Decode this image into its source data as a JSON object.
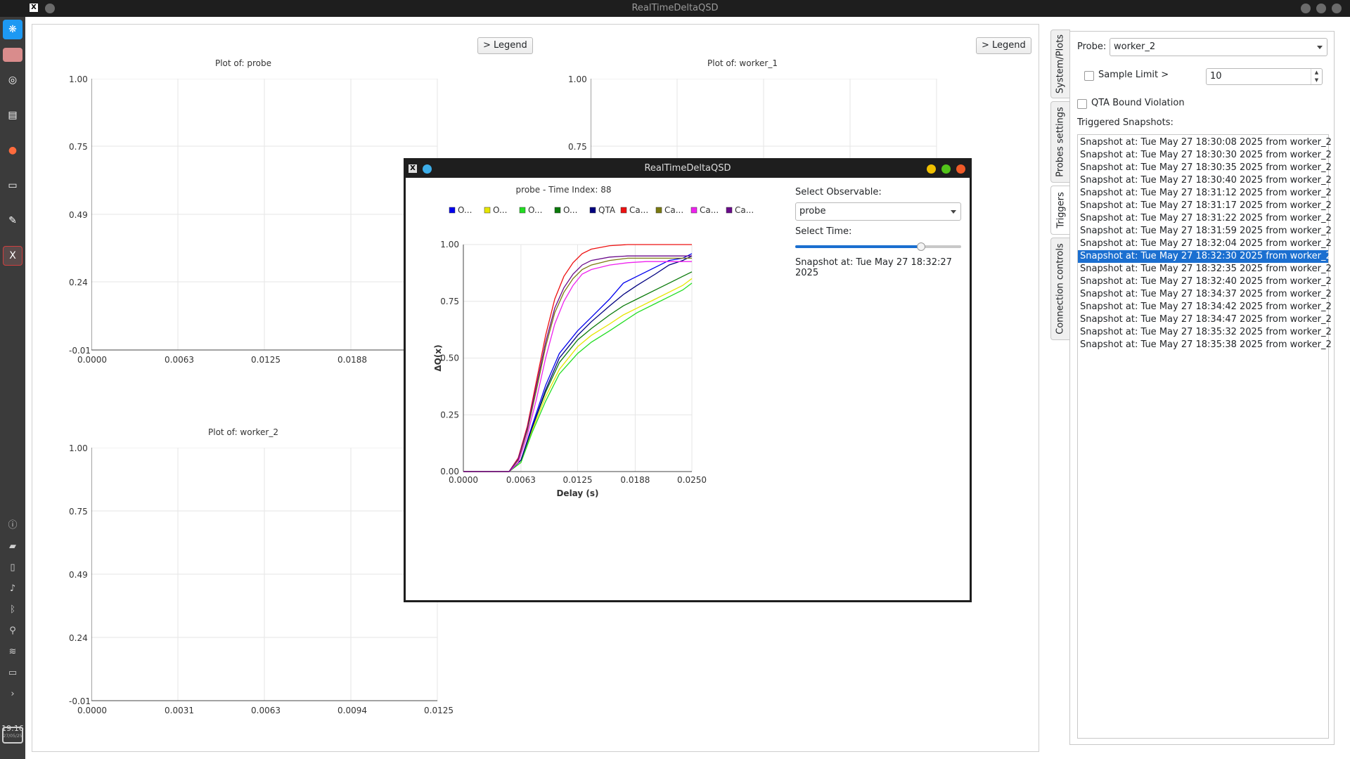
{
  "window": {
    "title": "RealTimeDeltaQSD"
  },
  "dock": {
    "clock_time": "19:16",
    "clock_date": "27/05/25"
  },
  "plots": [
    {
      "title": "Plot of: probe",
      "y_ticks": [
        "1.00",
        "0.75",
        "0.49",
        "0.24",
        "-0.01"
      ],
      "x_ticks": [
        "0.0000",
        "0.0063",
        "0.0125",
        "0.0188"
      ]
    },
    {
      "title": "Plot of: worker_1",
      "y_ticks": [
        "1.00",
        "0.75"
      ],
      "x_ticks": []
    },
    {
      "title": "Plot of: worker_2",
      "y_ticks": [
        "1.00",
        "0.75",
        "0.49",
        "0.24",
        "-0.01"
      ],
      "x_ticks": [
        "0.0000",
        "0.0031",
        "0.0063",
        "0.0094",
        "0.0125"
      ]
    }
  ],
  "legend_buttons": [
    "> Legend",
    "> Legend"
  ],
  "side_tabs": [
    "System/Plots",
    "Probes settings",
    "Triggers",
    "Connection controls"
  ],
  "right_panel": {
    "probe_label": "Probe:",
    "probe_value": "worker_2",
    "sample_limit_label": "Sample Limit >",
    "sample_limit_value": "10",
    "qta_label": "QTA Bound Violation",
    "triggered_label": "Triggered Snapshots:",
    "snapshots": [
      "Snapshot at: Tue May 27 18:30:08 2025 from worker_2",
      "Snapshot at: Tue May 27 18:30:30 2025 from worker_2",
      "Snapshot at: Tue May 27 18:30:35 2025 from worker_2",
      "Snapshot at: Tue May 27 18:30:40 2025 from worker_2",
      "Snapshot at: Tue May 27 18:31:12 2025 from worker_2",
      "Snapshot at: Tue May 27 18:31:17 2025 from worker_2",
      "Snapshot at: Tue May 27 18:31:22 2025 from worker_2",
      "Snapshot at: Tue May 27 18:31:59 2025 from worker_2",
      "Snapshot at: Tue May 27 18:32:04 2025 from worker_2",
      "Snapshot at: Tue May 27 18:32:30 2025 from worker_2",
      "Snapshot at: Tue May 27 18:32:35 2025 from worker_2",
      "Snapshot at: Tue May 27 18:32:40 2025 from worker_2",
      "Snapshot at: Tue May 27 18:34:37 2025 from worker_2",
      "Snapshot at: Tue May 27 18:34:42 2025 from worker_2",
      "Snapshot at: Tue May 27 18:34:47 2025 from worker_2",
      "Snapshot at: Tue May 27 18:35:32 2025 from worker_2",
      "Snapshot at: Tue May 27 18:35:38 2025 from worker_2"
    ],
    "selected_index": 9
  },
  "popup": {
    "title": "RealTimeDeltaQSD",
    "select_observable_label": "Select Observable:",
    "observable_value": "probe",
    "select_time_label": "Select Time:",
    "time_slider_fraction": 0.76,
    "snapshot_text": "Snapshot at: Tue May 27 18:32:27 2025"
  },
  "chart_data": {
    "type": "line",
    "title": "probe - Time Index: 88",
    "xlabel": "Delay (s)",
    "ylabel": "ΔQ(x)",
    "xlim": [
      0,
      0.025
    ],
    "ylim": [
      0,
      1
    ],
    "x_ticks": [
      "0.0000",
      "0.0063",
      "0.0125",
      "0.0188",
      "0.0250"
    ],
    "y_ticks": [
      "0.00",
      "0.25",
      "0.50",
      "0.75",
      "1.00"
    ],
    "grid": true,
    "legend_position": "top",
    "series": [
      {
        "name": "O...",
        "color": "#0000ee",
        "x": [
          0,
          0.005,
          0.0063,
          0.0075,
          0.009,
          0.0105,
          0.0125,
          0.014,
          0.016,
          0.0175,
          0.019,
          0.021,
          0.0225,
          0.024,
          0.025
        ],
        "y": [
          0,
          0,
          0.05,
          0.2,
          0.38,
          0.52,
          0.62,
          0.68,
          0.76,
          0.83,
          0.86,
          0.9,
          0.93,
          0.94,
          0.96
        ]
      },
      {
        "name": "O...",
        "color": "#e6e600",
        "x": [
          0,
          0.005,
          0.0063,
          0.0075,
          0.009,
          0.0105,
          0.0125,
          0.014,
          0.016,
          0.0175,
          0.019,
          0.021,
          0.0225,
          0.024,
          0.025
        ],
        "y": [
          0,
          0,
          0.04,
          0.18,
          0.33,
          0.45,
          0.55,
          0.6,
          0.65,
          0.69,
          0.72,
          0.76,
          0.79,
          0.82,
          0.85
        ]
      },
      {
        "name": "O...",
        "color": "#22dd22",
        "x": [
          0,
          0.005,
          0.0063,
          0.0075,
          0.009,
          0.0105,
          0.0125,
          0.014,
          0.016,
          0.0175,
          0.019,
          0.021,
          0.0225,
          0.024,
          0.025
        ],
        "y": [
          0,
          0,
          0.04,
          0.17,
          0.31,
          0.43,
          0.52,
          0.57,
          0.62,
          0.66,
          0.7,
          0.74,
          0.77,
          0.8,
          0.83
        ]
      },
      {
        "name": "O...",
        "color": "#0a7a0a",
        "x": [
          0,
          0.005,
          0.0063,
          0.0075,
          0.009,
          0.0105,
          0.0125,
          0.014,
          0.016,
          0.0175,
          0.019,
          0.021,
          0.0225,
          0.024,
          0.025
        ],
        "y": [
          0,
          0,
          0.05,
          0.19,
          0.35,
          0.48,
          0.58,
          0.63,
          0.69,
          0.73,
          0.76,
          0.8,
          0.83,
          0.86,
          0.88
        ]
      },
      {
        "name": "QTA",
        "color": "#000080",
        "x": [
          0,
          0.005,
          0.0063,
          0.0075,
          0.009,
          0.0105,
          0.0125,
          0.014,
          0.016,
          0.0175,
          0.019,
          0.021,
          0.0225,
          0.024,
          0.025
        ],
        "y": [
          0,
          0,
          0.05,
          0.19,
          0.36,
          0.5,
          0.6,
          0.66,
          0.73,
          0.78,
          0.82,
          0.87,
          0.91,
          0.93,
          0.95
        ]
      },
      {
        "name": "Ca...",
        "color": "#ee1111",
        "x": [
          0,
          0.005,
          0.006,
          0.007,
          0.008,
          0.009,
          0.01,
          0.011,
          0.012,
          0.013,
          0.014,
          0.016,
          0.018,
          0.02,
          0.025
        ],
        "y": [
          0,
          0,
          0.06,
          0.2,
          0.4,
          0.6,
          0.76,
          0.86,
          0.92,
          0.96,
          0.98,
          0.995,
          1.0,
          1.0,
          1.0
        ]
      },
      {
        "name": "Ca...",
        "color": "#7a7a10",
        "x": [
          0,
          0.005,
          0.006,
          0.007,
          0.008,
          0.009,
          0.01,
          0.011,
          0.012,
          0.013,
          0.014,
          0.016,
          0.018,
          0.02,
          0.025
        ],
        "y": [
          0,
          0,
          0.05,
          0.18,
          0.36,
          0.55,
          0.7,
          0.79,
          0.85,
          0.89,
          0.91,
          0.93,
          0.94,
          0.94,
          0.94
        ]
      },
      {
        "name": "Ca...",
        "color": "#ee22ee",
        "x": [
          0,
          0.005,
          0.006,
          0.007,
          0.008,
          0.009,
          0.01,
          0.011,
          0.012,
          0.013,
          0.014,
          0.016,
          0.018,
          0.02,
          0.025
        ],
        "y": [
          0,
          0,
          0.04,
          0.16,
          0.32,
          0.5,
          0.65,
          0.75,
          0.82,
          0.87,
          0.89,
          0.91,
          0.92,
          0.925,
          0.925
        ]
      },
      {
        "name": "Ca...",
        "color": "#6a0a8a",
        "x": [
          0,
          0.005,
          0.006,
          0.007,
          0.008,
          0.009,
          0.01,
          0.011,
          0.012,
          0.013,
          0.014,
          0.016,
          0.018,
          0.02,
          0.025
        ],
        "y": [
          0,
          0,
          0.055,
          0.19,
          0.38,
          0.57,
          0.72,
          0.81,
          0.87,
          0.91,
          0.93,
          0.945,
          0.95,
          0.95,
          0.95
        ]
      }
    ]
  },
  "colors": {
    "accent": "#1b6fd0",
    "titlebar": "#1e1e1e",
    "dock": "#3b3b3b"
  }
}
